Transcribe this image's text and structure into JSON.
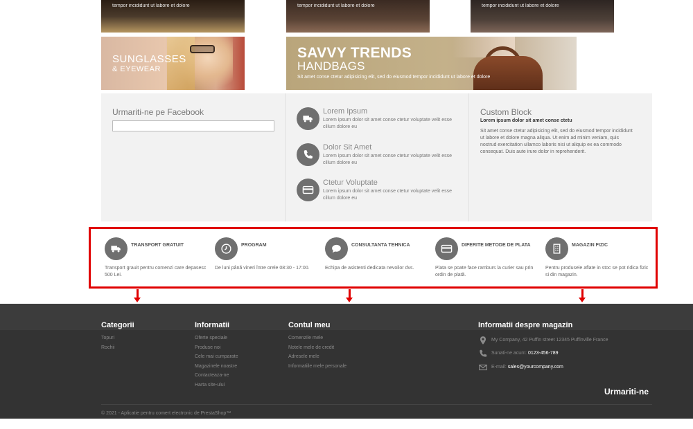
{
  "banners": {
    "top": [
      {
        "line1": "",
        "line2": "tempor incididunt ut labore et dolore"
      },
      {
        "line1": "",
        "line2": "tempor incididunt ut labore et dolore"
      },
      {
        "line1": "",
        "line2": "tempor incididunt ut labore et dolore"
      }
    ],
    "sunglasses": {
      "title": "SUNGLASSES",
      "subtitle": "& EYEWEAR"
    },
    "handbags": {
      "title": "SAVVY TRENDS",
      "subtitle": "HANDBAGS",
      "desc": "Sit amet conse ctetur adipisicing elit, sed do eiusmod tempor incididunt ut labore et dolore"
    }
  },
  "facebook": {
    "title": "Urmariti-ne pe Facebook"
  },
  "features": [
    {
      "icon": "truck-icon",
      "title": "Lorem Ipsum",
      "desc": "Lorem ipsum dolor sit amet conse ctetur voluptate velit esse cillum dolore eu"
    },
    {
      "icon": "phone-icon",
      "title": "Dolor Sit Amet",
      "desc": "Lorem ipsum dolor sit amet conse ctetur voluptate velit esse cillum dolore eu"
    },
    {
      "icon": "credit-card-icon",
      "title": "Ctetur Voluptate",
      "desc": "Lorem ipsum dolor sit amet conse ctetur voluptate velit esse cillum dolore eu"
    }
  ],
  "custom_block": {
    "title": "Custom Block",
    "subtitle": "Lorem ipsum dolor sit amet conse ctetu",
    "body": "Sit amet conse ctetur adipisicing elit, sed do eiusmod tempor incididunt ut labore et dolore magna aliqua. Ut enim ad minim veniam, quis nostrud exercitation ullamco laboris nisi ut aliquip ex ea commodo consequat. Duis aute irure dolor in reprehenderit."
  },
  "services": [
    {
      "icon": "truck-icon",
      "title": "TRANSPORT GRATUIT",
      "desc": "Transport grauit pentru comenzi care depasesc 500 Lei."
    },
    {
      "icon": "clock-icon",
      "title": "PROGRAM",
      "desc": "De luni până vineri între orele 08:30 - 17:00."
    },
    {
      "icon": "chat-icon",
      "title": "CONSULTANTA TEHNICA",
      "desc": "Echipa de asistenti dedicata nevoilor dvs."
    },
    {
      "icon": "credit-card-icon",
      "title": "DIFERITE METODE DE PLATA",
      "desc": "Plata se poate face ramburs la curier sau prin ordin de plată."
    },
    {
      "icon": "building-icon",
      "title": "MAGAZIN FIZIC",
      "desc": "Pentru produsele aflate in stoc se pot ridica fizic si din magazin."
    }
  ],
  "footer": {
    "categories": {
      "title": "Categorii",
      "items": [
        "Topuri",
        "Rochii"
      ]
    },
    "info": {
      "title": "Informatii",
      "items": [
        "Oferte speciale",
        "Produse noi",
        "Cele mai cumparate",
        "Magazinele noastre",
        "Contacteaza-ne",
        "Harta site-ului"
      ]
    },
    "account": {
      "title": "Contul meu",
      "items": [
        "Comenzile mele",
        "Notele mele de credit",
        "Adresele mele",
        "Informatiile mele personale"
      ]
    },
    "store": {
      "title": "Informatii despre magazin",
      "address": "My Company, 42 Puffin street 12345 Puffinville France",
      "phone_label": "Sunati-ne acum:",
      "phone": "0123-456-789",
      "email_label": "E-mail:",
      "email": "sales@yourcompany.com"
    },
    "follow": "Urmariti-ne",
    "copyright": "© 2021 - Aplicatie pentru comert electronic de PrestaShop™"
  },
  "colors": {
    "highlight": "#e00000",
    "footer_bg": "#333333",
    "icon_bg": "#6f6f6f"
  }
}
